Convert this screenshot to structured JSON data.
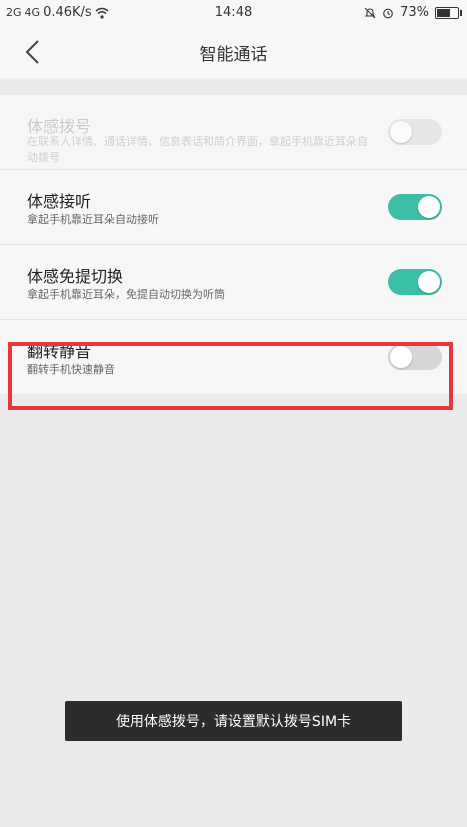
{
  "status_bar": {
    "signal1": "2G",
    "signal2": "4G",
    "net_speed": "0.46K/s",
    "time": "14:48",
    "battery_pct": "73%",
    "battery_level": 0.73
  },
  "header": {
    "title": "智能通话"
  },
  "settings": [
    {
      "title": "体感拨号",
      "subtitle": "在联系人详情、通话详情、信息表话和简介界面，拿起手机靠近耳朵自动拨号",
      "state": "off",
      "enabled": false
    },
    {
      "title": "体感接听",
      "subtitle": "拿起手机靠近耳朵自动接听",
      "state": "on",
      "enabled": true
    },
    {
      "title": "体感免提切换",
      "subtitle": "拿起手机靠近耳朵，免提自动切换为听筒",
      "state": "on",
      "enabled": true
    },
    {
      "title": "翻转静音",
      "subtitle": "翻转手机快速静音",
      "state": "off",
      "enabled": true
    }
  ],
  "toast": {
    "text": "使用体感拨号，请设置默认拨号SIM卡"
  },
  "colors": {
    "accent": "#3bbfa7",
    "highlight": "#e8373b"
  }
}
